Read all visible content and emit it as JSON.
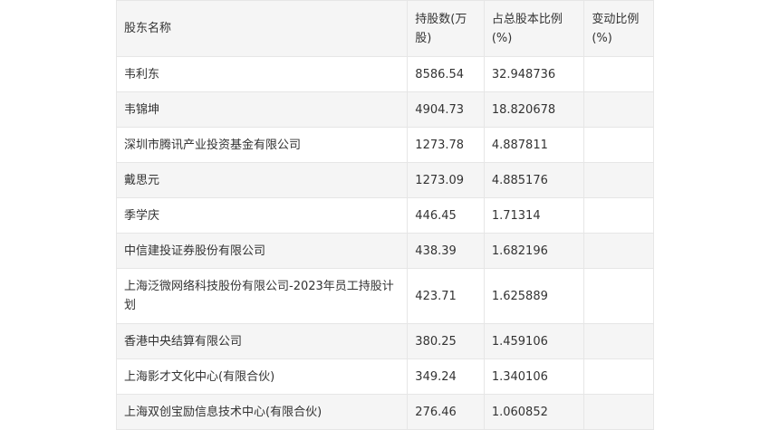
{
  "table": {
    "headers": [
      "股东名称",
      "持股数(万股)",
      "占总股本比例(%)",
      "变动比例(%)"
    ],
    "rows": [
      [
        "韦利东",
        "8586.54",
        "32.948736",
        ""
      ],
      [
        "韦锦坤",
        "4904.73",
        "18.820678",
        ""
      ],
      [
        "深圳市腾讯产业投资基金有限公司",
        "1273.78",
        "4.887811",
        ""
      ],
      [
        "戴思元",
        "1273.09",
        "4.885176",
        ""
      ],
      [
        "季学庆",
        "446.45",
        "1.71314",
        ""
      ],
      [
        "中信建投证券股份有限公司",
        "438.39",
        "1.682196",
        ""
      ],
      [
        "上海泛微网络科技股份有限公司-2023年员工持股计划",
        "423.71",
        "1.625889",
        ""
      ],
      [
        "香港中央结算有限公司",
        "380.25",
        "1.459106",
        ""
      ],
      [
        "上海影才文化中心(有限合伙)",
        "349.24",
        "1.340106",
        ""
      ],
      [
        "上海双创宝励信息技术中心(有限合伙)",
        "276.46",
        "1.060852",
        ""
      ]
    ]
  }
}
